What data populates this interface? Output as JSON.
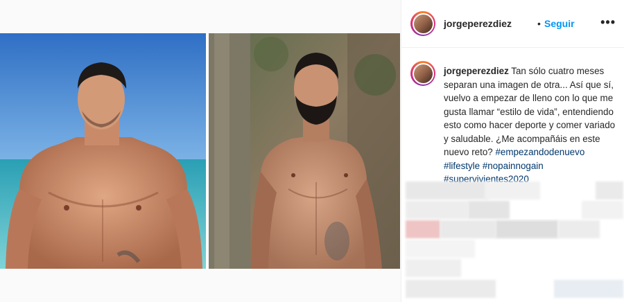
{
  "post": {
    "author": {
      "username": "jorgeperezdiez",
      "separator": "•",
      "follow_label": "Seguir",
      "more_icon": "more-options-icon",
      "more_label": "•••"
    },
    "caption": {
      "username": "jorgeperezdiez",
      "body": "Tan sólo cuatro meses separan una imagen de otra... Así que sí, vuelvo a empezar de lleno con lo que me gusta llamar “estilo de vida”, entendiendo esto como hacer deporte y comer variado y saludable. ¿Me acompañáis en este nuevo reto?",
      "hashtags": [
        "#empezandodenuevo",
        "#lifestyle",
        "#nopainnogain",
        "#supervivientes2020"
      ]
    },
    "media": {
      "left_photo_icon": "beach-portrait-photo",
      "right_photo_icon": "jungle-portrait-photo"
    }
  },
  "colors": {
    "follow": "#0095f6",
    "hashtag": "#00376b",
    "text": "#262626",
    "border": "#efefef"
  }
}
